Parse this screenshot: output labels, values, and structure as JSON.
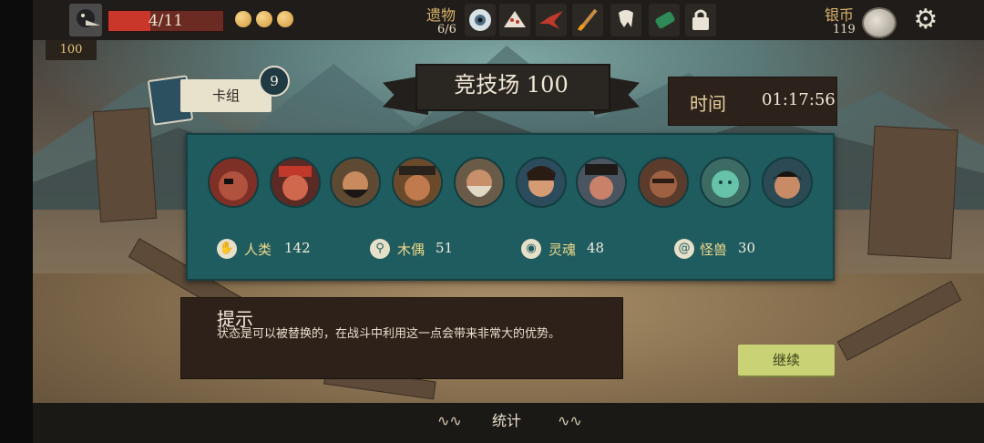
{
  "topbar": {
    "hp_current": 4,
    "hp_max": 11,
    "hp_text": "4/11",
    "energy_orbs": 3,
    "relics_label": "遗物",
    "relics_count": "6/6",
    "relics": [
      "eye-relic",
      "fan-relic",
      "paper-crane-relic",
      "feather-torch-relic",
      "tooth-relic",
      "green-vial-relic",
      "locked-slot"
    ],
    "silver_label": "银币",
    "silver_count": "119"
  },
  "level_badge": "100",
  "deck": {
    "label": "卡组",
    "count": "9"
  },
  "arena": {
    "title": "竞技场 100"
  },
  "timer": {
    "label": "时间",
    "value": "01:17:56"
  },
  "opponents": [
    "pirate-red-eyepatch",
    "pirate-red-bandana",
    "bearded-captain",
    "pirate-hat",
    "horned-bearded",
    "blue-sailor",
    "tricorn-captain",
    "masked-brute",
    "ghost-green",
    "dark-hair-pirate"
  ],
  "stats": [
    {
      "icon": "human-icon",
      "label": "人类",
      "value": "142"
    },
    {
      "icon": "puppet-icon",
      "label": "木偶",
      "value": "51"
    },
    {
      "icon": "soul-icon",
      "label": "灵魂",
      "value": "48"
    },
    {
      "icon": "beast-icon",
      "label": "怪兽",
      "value": "30"
    }
  ],
  "tip": {
    "title": "提示",
    "body": "状态是可以被替换的，在战斗中利用这一点会带来非常大的优势。"
  },
  "continue_label": "继续",
  "bottom": {
    "stats_tab": "统计"
  },
  "colors": {
    "panel": "#1f5c5f",
    "accent_gold": "#f0d98a",
    "continue_button": "#c9d275",
    "hp_red": "#c9372b"
  }
}
